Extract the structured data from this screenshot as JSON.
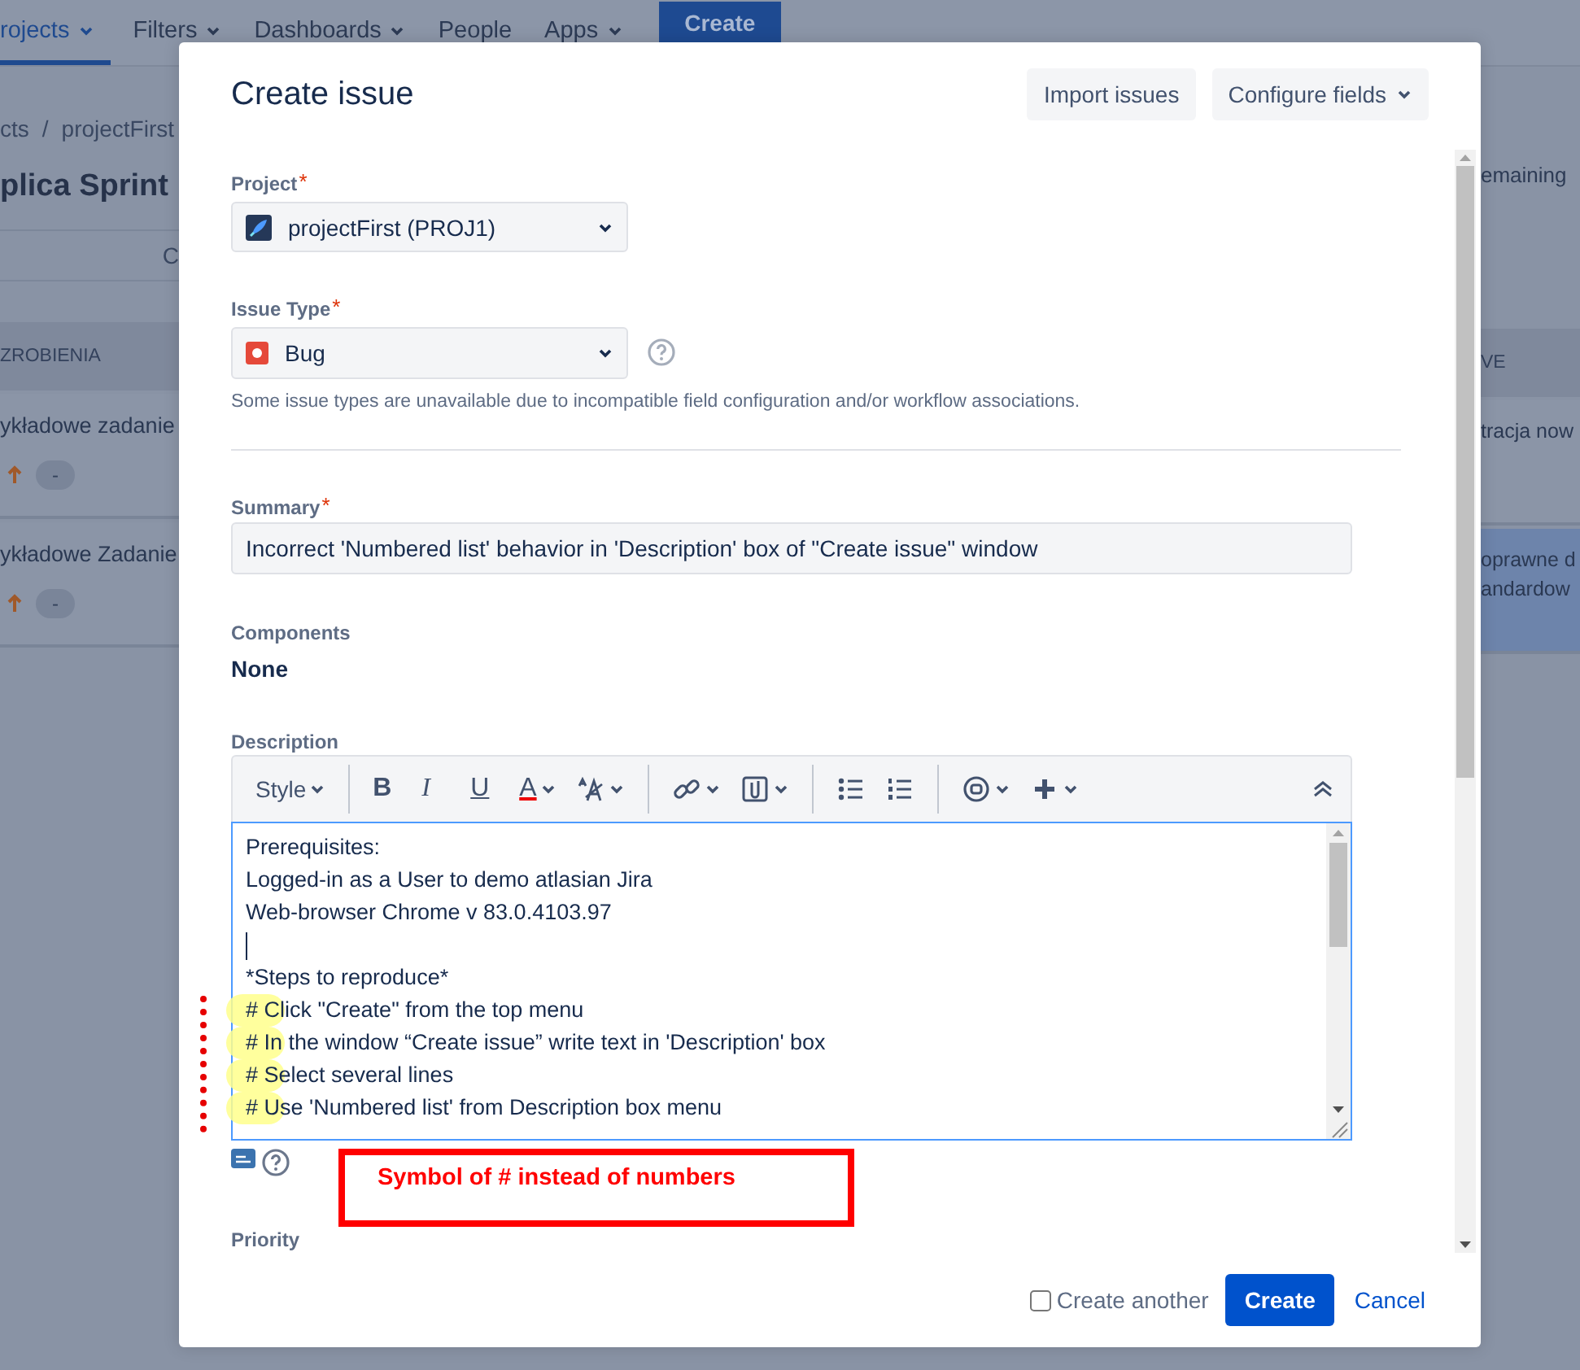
{
  "nav": {
    "items": [
      {
        "label": "rojects",
        "selected": true,
        "dropdown": true
      },
      {
        "label": "Filters",
        "selected": false,
        "dropdown": true
      },
      {
        "label": "Dashboards",
        "selected": false,
        "dropdown": true
      },
      {
        "label": "People",
        "selected": false,
        "dropdown": false
      },
      {
        "label": "Apps",
        "selected": false,
        "dropdown": true
      }
    ],
    "create": "Create"
  },
  "board": {
    "breadcrumb": [
      "cts",
      "projectFirst"
    ],
    "separator": "/",
    "title": "plica Sprint",
    "button": "C",
    "left_column": {
      "header": "ZROBIENIA",
      "cards": [
        {
          "title": "ykładowe zadanie",
          "estimate": "-"
        },
        {
          "title": "ykładowe Zadanie",
          "estimate": "-"
        }
      ]
    },
    "right_column": {
      "remaining": "emaining",
      "header": "VE",
      "cards": [
        {
          "lines": [
            "tracja now"
          ],
          "selected": false
        },
        {
          "lines": [
            "oprawne d",
            "andardow"
          ],
          "selected": true
        }
      ]
    }
  },
  "dialog": {
    "title": "Create issue",
    "header_buttons": [
      {
        "label": "Import issues",
        "dropdown": false
      },
      {
        "label": "Configure fields",
        "dropdown": true
      }
    ],
    "project": {
      "label": "Project",
      "required_mark": "*",
      "value": "projectFirst (PROJ1)"
    },
    "issue_type": {
      "label": "Issue Type",
      "required_mark": "*",
      "value": "Bug",
      "hint": "Some issue types are unavailable due to incompatible field configuration and/or workflow associations."
    },
    "summary": {
      "label": "Summary",
      "required_mark": "*",
      "value": "Incorrect 'Numbered list' behavior in 'Description' box of \"Create issue\" window"
    },
    "components": {
      "label": "Components",
      "value": "None"
    },
    "description": {
      "label": "Description",
      "toolbar": [
        {
          "kind": "style",
          "label": "Style"
        },
        {
          "kind": "divider"
        },
        {
          "kind": "bold",
          "label": "B"
        },
        {
          "kind": "italic",
          "label": "I"
        },
        {
          "kind": "underline",
          "label": "U"
        },
        {
          "kind": "color",
          "label": "A"
        },
        {
          "kind": "size"
        },
        {
          "kind": "divider"
        },
        {
          "kind": "link"
        },
        {
          "kind": "attach"
        },
        {
          "kind": "divider"
        },
        {
          "kind": "bullets"
        },
        {
          "kind": "numbers"
        },
        {
          "kind": "divider"
        },
        {
          "kind": "emoji"
        },
        {
          "kind": "plus"
        }
      ],
      "lines": [
        {
          "kind": "text",
          "text": "Prerequisites:",
          "highlighted": false
        },
        {
          "kind": "text",
          "text": "Logged-in as a User to demo atlasian Jira",
          "highlighted": false
        },
        {
          "kind": "text",
          "text": "Web-browser Chrome v 83.0.4103.97",
          "highlighted": false
        },
        {
          "kind": "cursor"
        },
        {
          "kind": "text",
          "text": "*Steps to reproduce*",
          "highlighted": false
        },
        {
          "kind": "text",
          "text": "# Click \"Create\" from the top menu",
          "highlighted": true
        },
        {
          "kind": "text",
          "text": "# In the window “Create issue” write text in 'Description' box",
          "highlighted": true
        },
        {
          "kind": "text",
          "text": "# Select several lines",
          "highlighted": true
        },
        {
          "kind": "text",
          "text": "# Use 'Numbered list' from Description box menu",
          "highlighted": true
        }
      ]
    },
    "annotation": {
      "text": "Symbol of # instead of numbers",
      "dotted_line": true
    },
    "priority": {
      "label": "Priority"
    },
    "create_another": {
      "label": "Create another",
      "checked": false
    },
    "submit": "Create",
    "cancel": "Cancel"
  }
}
